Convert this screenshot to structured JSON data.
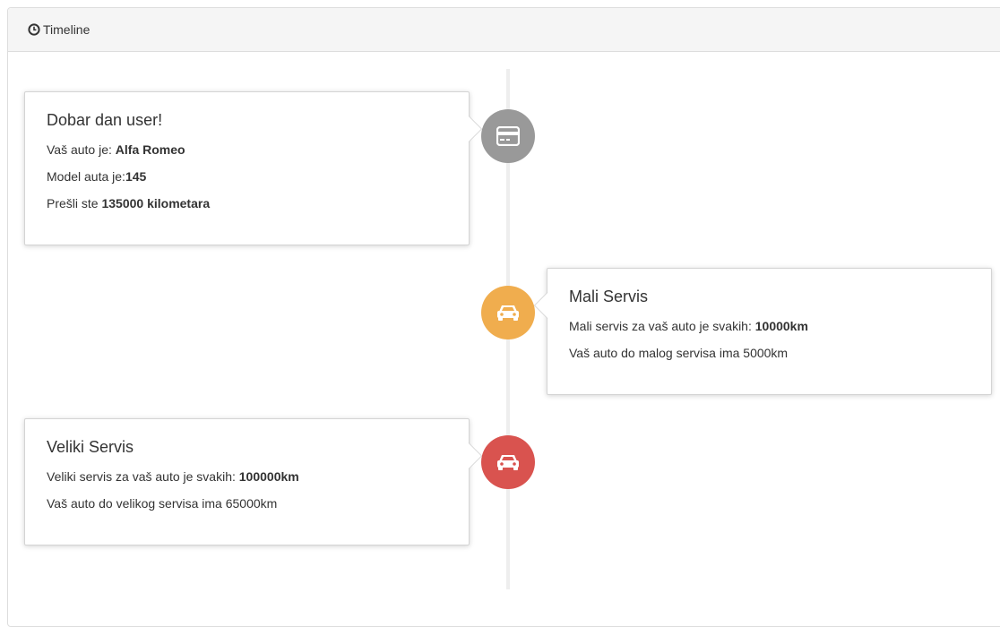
{
  "panel": {
    "title": "Timeline",
    "title_icon": "clock-icon"
  },
  "entries": [
    {
      "badge_icon": "credit-card-icon",
      "badge_color": "#999999",
      "title": "Dobar dan user!",
      "line1_prefix": "Vaš auto je: ",
      "line1_bold": "Alfa Romeo",
      "line2_prefix": "Model auta je:",
      "line2_bold": "145",
      "line3_prefix": "Prešli ste ",
      "line3_bold": "135000 kilometara"
    },
    {
      "badge_icon": "car-icon",
      "badge_color": "#f0ad4e",
      "title": "Mali Servis",
      "line1_prefix": "Mali servis za vaš auto je svakih: ",
      "line1_bold": "10000km",
      "line2_text": "Vaš auto do malog servisa ima 5000km"
    },
    {
      "badge_icon": "car-icon",
      "badge_color": "#d9534f",
      "title": "Veliki Servis",
      "line1_prefix": "Veliki servis za vaš auto je svakih: ",
      "line1_bold": "100000km",
      "line2_text": "Vaš auto do velikog servisa ima 65000km"
    }
  ]
}
